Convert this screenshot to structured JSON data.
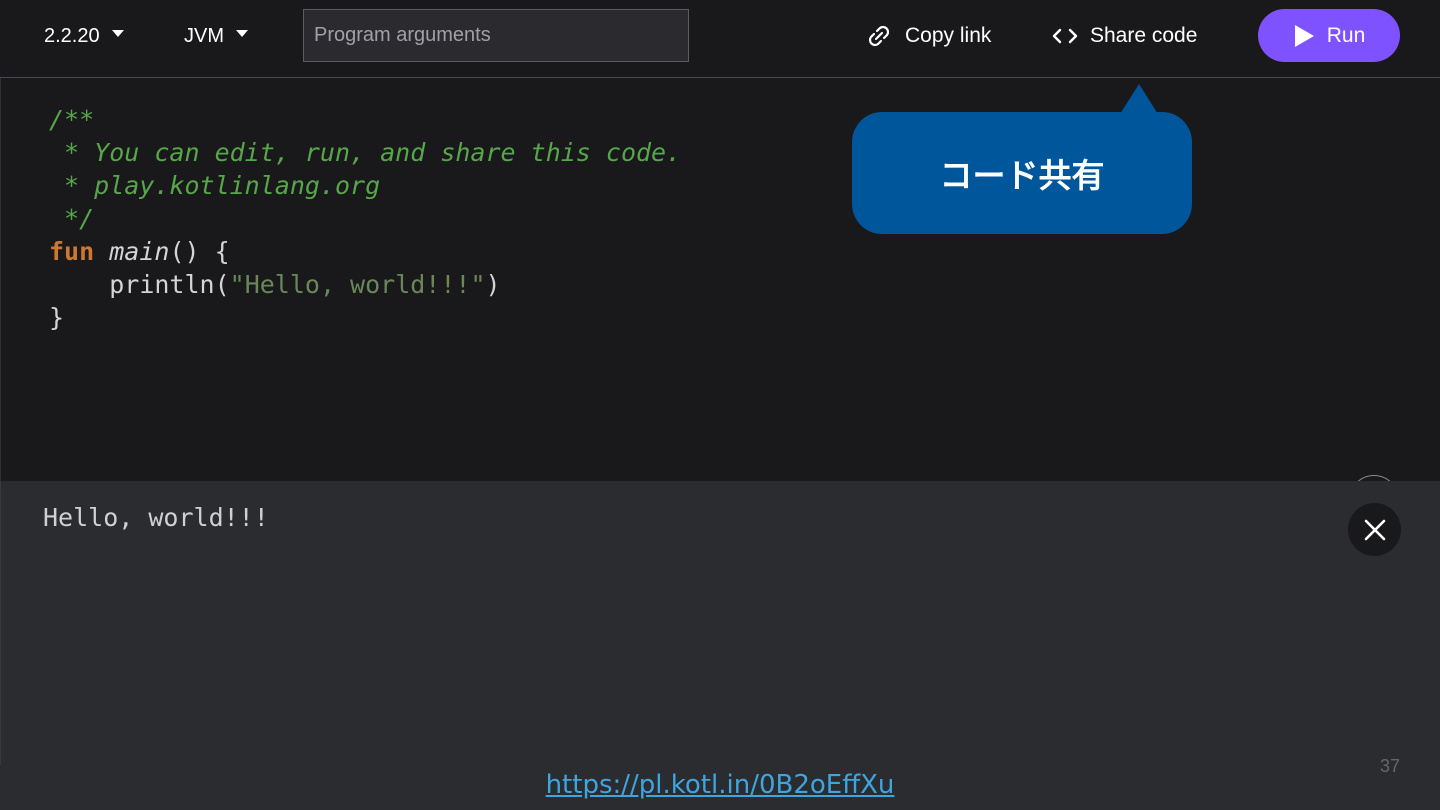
{
  "toolbar": {
    "version": "2.2.20",
    "target": "JVM",
    "args_placeholder": "Program arguments",
    "copy_link_label": "Copy link",
    "share_code_label": "Share code",
    "run_label": "Run",
    "run_color": "#7f52ff"
  },
  "editor": {
    "lines": [
      "/**",
      " * You can edit, run, and share this code.",
      " * play.kotlinlang.org",
      " */",
      {
        "kw": "fun",
        "name": "main",
        "rest": "() {"
      },
      {
        "indent": "    ",
        "call": "println(",
        "str": "\"Hello, world!!!\"",
        "end": ")"
      },
      "}"
    ],
    "help_label": "?"
  },
  "callout": {
    "text": "コード共有",
    "color": "#00569a"
  },
  "output": {
    "text": "Hello, world!!!"
  },
  "slide": {
    "page_number": "37",
    "link": "https://pl.kotl.in/0B2oEffXu"
  },
  "icons": {
    "copy_link": "link-icon",
    "share_code": "code-brackets-icon",
    "run": "play-icon",
    "close": "close-icon"
  }
}
